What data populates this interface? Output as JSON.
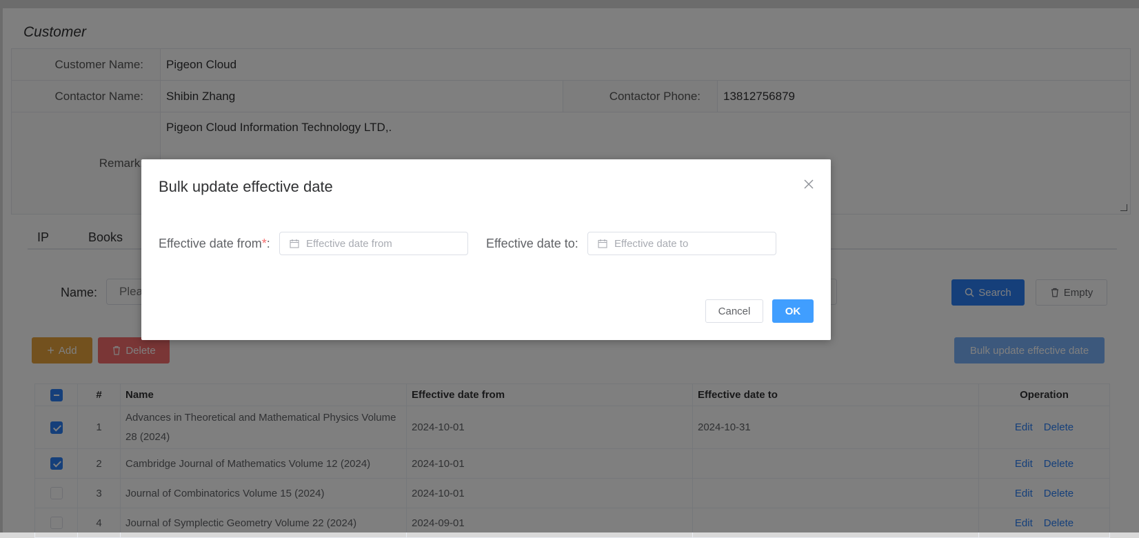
{
  "card": {
    "title": "Customer"
  },
  "customer": {
    "name_label": "Customer Name:",
    "name_value": "Pigeon Cloud",
    "contactor_label": "Contactor Name:",
    "contactor_value": "Shibin Zhang",
    "phone_label": "Contactor Phone:",
    "phone_value": "13812756879",
    "remark_label": "Remark:",
    "remark_value": "Pigeon Cloud Information Technology LTD,."
  },
  "tabs": [
    {
      "label": "IP"
    },
    {
      "label": "Books"
    }
  ],
  "search": {
    "label": "Name:",
    "placeholder": "Please enter",
    "search_button": "Search",
    "empty_button": "Empty"
  },
  "toolbar": {
    "add_label": "Add",
    "delete_label": "Delete",
    "bulk_label": "Bulk update effective date"
  },
  "table": {
    "columns": [
      "#",
      "Name",
      "Effective date from",
      "Effective date to",
      "Operation"
    ],
    "rows": [
      {
        "index": "1",
        "name": "Advances in Theoretical and Mathematical Physics Volume 28 (2024)",
        "from": "2024-10-01",
        "to": "2024-10-31",
        "checked": true
      },
      {
        "index": "2",
        "name": "Cambridge Journal of Mathematics Volume 12 (2024)",
        "from": "2024-10-01",
        "to": "",
        "checked": true
      },
      {
        "index": "3",
        "name": "Journal of Combinatorics Volume 15 (2024)",
        "from": "2024-10-01",
        "to": "",
        "checked": false
      },
      {
        "index": "4",
        "name": "Journal of Symplectic Geometry Volume 22 (2024)",
        "from": "2024-09-01",
        "to": "",
        "checked": false
      }
    ],
    "edit_label": "Edit",
    "delete_label": "Delete"
  },
  "dialog": {
    "title": "Bulk update effective date",
    "from_label": "Effective date from",
    "required_mark": "*",
    "colon": ":",
    "from_placeholder": "Effective date from",
    "to_label": "Effective date to",
    "to_placeholder": "Effective date to",
    "cancel_label": "Cancel",
    "ok_label": "OK"
  },
  "colors": {
    "primary": "#2a7ff5",
    "warning": "#e6a23c",
    "danger": "#f56c6c",
    "overlay": "rgba(0,0,0,0.5)"
  },
  "icons": [
    "calendar-icon",
    "close-icon",
    "search-icon",
    "trash-icon",
    "plus-icon"
  ]
}
